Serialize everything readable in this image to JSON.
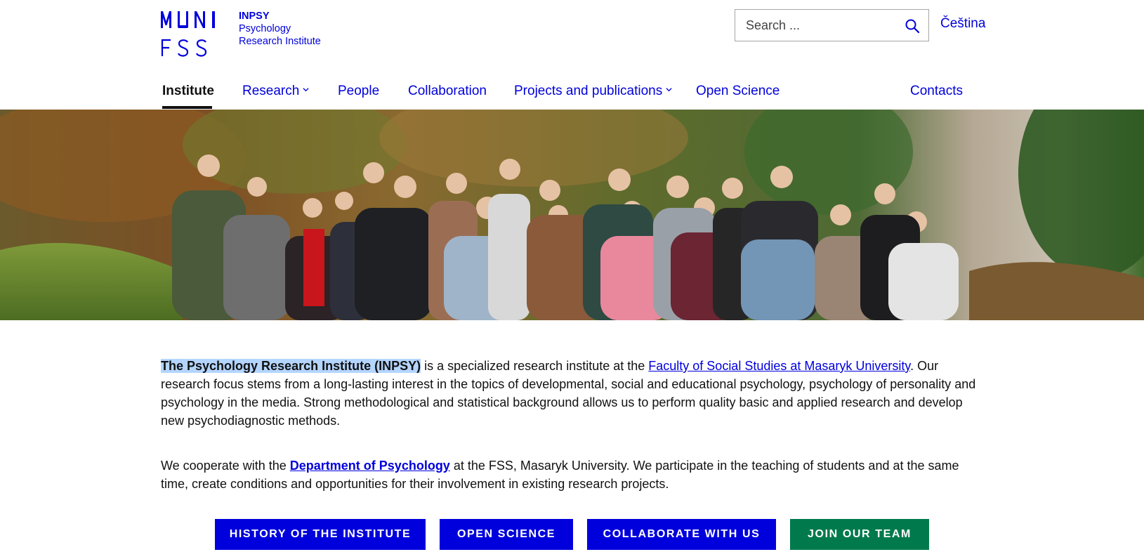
{
  "logo": {
    "abbr": "INPSY",
    "line1": "Psychology",
    "line2": "Research Institute",
    "mark_top": "MUNI",
    "mark_bottom": "FSS"
  },
  "search": {
    "placeholder": "Search ...",
    "value": ""
  },
  "language": "Čeština",
  "nav": {
    "items": [
      {
        "label": "Institute",
        "active": true
      },
      {
        "label": "Research",
        "dropdown": true
      },
      {
        "label": "People"
      },
      {
        "label": "Collaboration"
      },
      {
        "label": "Projects and publications",
        "dropdown": true
      },
      {
        "label": "Open Science"
      }
    ],
    "contacts": "Contacts"
  },
  "hero": {
    "alt": ""
  },
  "intro": {
    "highlight": "The Psychology Research Institute (INPSY)",
    "text1": " is a specialized research institute at the ",
    "link1": "Faculty of Social Studies at Masaryk University",
    "text2": ". Our research focus stems from a long-lasting interest in the topics of developmental, social and educational psychology, psychology of personality and psychology in the media. Strong methodological and statistical background allows us to perform quality basic and applied research and develop new psychodiagnostic methods."
  },
  "cooperation": {
    "text1": "We cooperate with the ",
    "link": "Department of Psychology",
    "text2": " at the FSS, Masaryk University. We participate in the teaching of students and at the same time, create conditions and opportunities for their involvement in existing research projects."
  },
  "buttons": [
    {
      "label": "HISTORY OF THE INSTITUTE"
    },
    {
      "label": "OPEN SCIENCE"
    },
    {
      "label": "COLLABORATE WITH US"
    },
    {
      "label": "JOIN OUR TEAM"
    }
  ],
  "colors": {
    "brand_blue": "#0000dc",
    "green": "#007a4d",
    "highlight": "#b4d5fe"
  }
}
